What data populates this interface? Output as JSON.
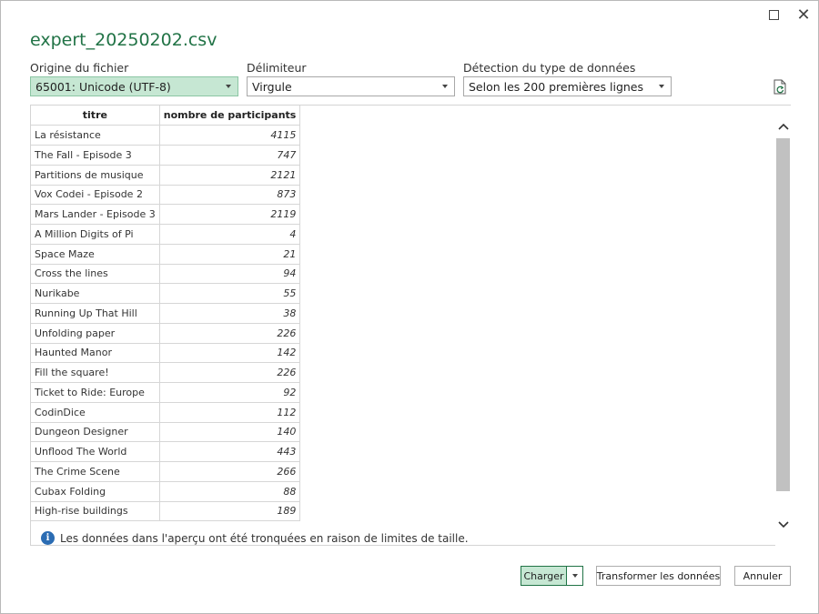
{
  "window": {
    "title": "expert_20250202.csv",
    "maximize_glyph": "",
    "close_glyph": "✕"
  },
  "options": {
    "origin": {
      "label": "Origine du fichier",
      "value": "65001: Unicode (UTF-8)"
    },
    "delimiter": {
      "label": "Délimiteur",
      "value": "Virgule"
    },
    "detection": {
      "label": "Détection du type de données",
      "value": "Selon les 200 premières lignes"
    }
  },
  "refresh_icon": "refresh-document-icon",
  "preview": {
    "columns": [
      "titre",
      "nombre de participants"
    ],
    "rows": [
      [
        "La résistance",
        "4115"
      ],
      [
        "The Fall - Episode 3",
        "747"
      ],
      [
        "Partitions de musique",
        "2121"
      ],
      [
        "Vox Codei - Episode 2",
        "873"
      ],
      [
        "Mars Lander - Episode 3",
        "2119"
      ],
      [
        "A Million Digits of Pi",
        "4"
      ],
      [
        "Space Maze",
        "21"
      ],
      [
        "Cross the lines",
        "94"
      ],
      [
        "Nurikabe",
        "55"
      ],
      [
        "Running Up That Hill",
        "38"
      ],
      [
        "Unfolding paper",
        "226"
      ],
      [
        "Haunted Manor",
        "142"
      ],
      [
        "Fill the square!",
        "226"
      ],
      [
        "Ticket to Ride: Europe",
        "92"
      ],
      [
        "CodinDice",
        "112"
      ],
      [
        "Dungeon Designer",
        "140"
      ],
      [
        "Unflood The World",
        "443"
      ],
      [
        "The Crime Scene",
        "266"
      ],
      [
        "Cubax Folding",
        "88"
      ],
      [
        "High-rise buildings",
        "189"
      ]
    ],
    "note": "Les données dans l'aperçu ont été tronquées en raison de limites de taille.",
    "info_glyph": "i"
  },
  "buttons": {
    "load": "Charger",
    "transform": "Transformer les données",
    "cancel": "Annuler"
  },
  "colors": {
    "accent": "#217346",
    "selected_bg": "#c6e7d3",
    "info": "#2b6cb3"
  }
}
